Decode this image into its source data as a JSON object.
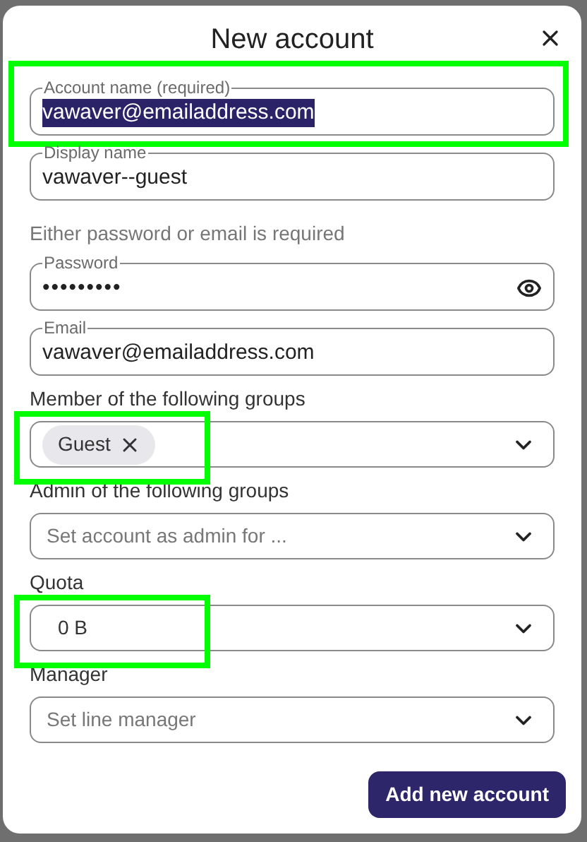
{
  "dialog": {
    "title": "New account",
    "fields": [
      {
        "kind": "text",
        "label": "Account name (required)",
        "value": "vawaver@emailaddress.com",
        "text_selected": true,
        "highlighted": true
      },
      {
        "kind": "text",
        "label": "Display name",
        "value": "vawaver--guest",
        "text_selected": false,
        "highlighted": false
      },
      {
        "kind": "note",
        "text": "Either password or email is required"
      },
      {
        "kind": "password",
        "label": "Password",
        "value": "•••••••••",
        "highlighted": false
      },
      {
        "kind": "text",
        "label": "Email",
        "value": "vawaver@emailaddress.com",
        "text_selected": false,
        "highlighted": false
      },
      {
        "kind": "select",
        "label": "Member of the following groups",
        "tags": [
          {
            "label": "Guest"
          }
        ],
        "highlighted": true
      },
      {
        "kind": "select",
        "label": "Admin of the following groups",
        "placeholder": "Set account as admin for ...",
        "highlighted": false
      },
      {
        "kind": "select",
        "label": "Quota",
        "value": "0 B",
        "highlighted": true
      },
      {
        "kind": "select",
        "label": "Manager",
        "placeholder": "Set line manager",
        "highlighted": false
      }
    ],
    "submit": "Add new account"
  }
}
